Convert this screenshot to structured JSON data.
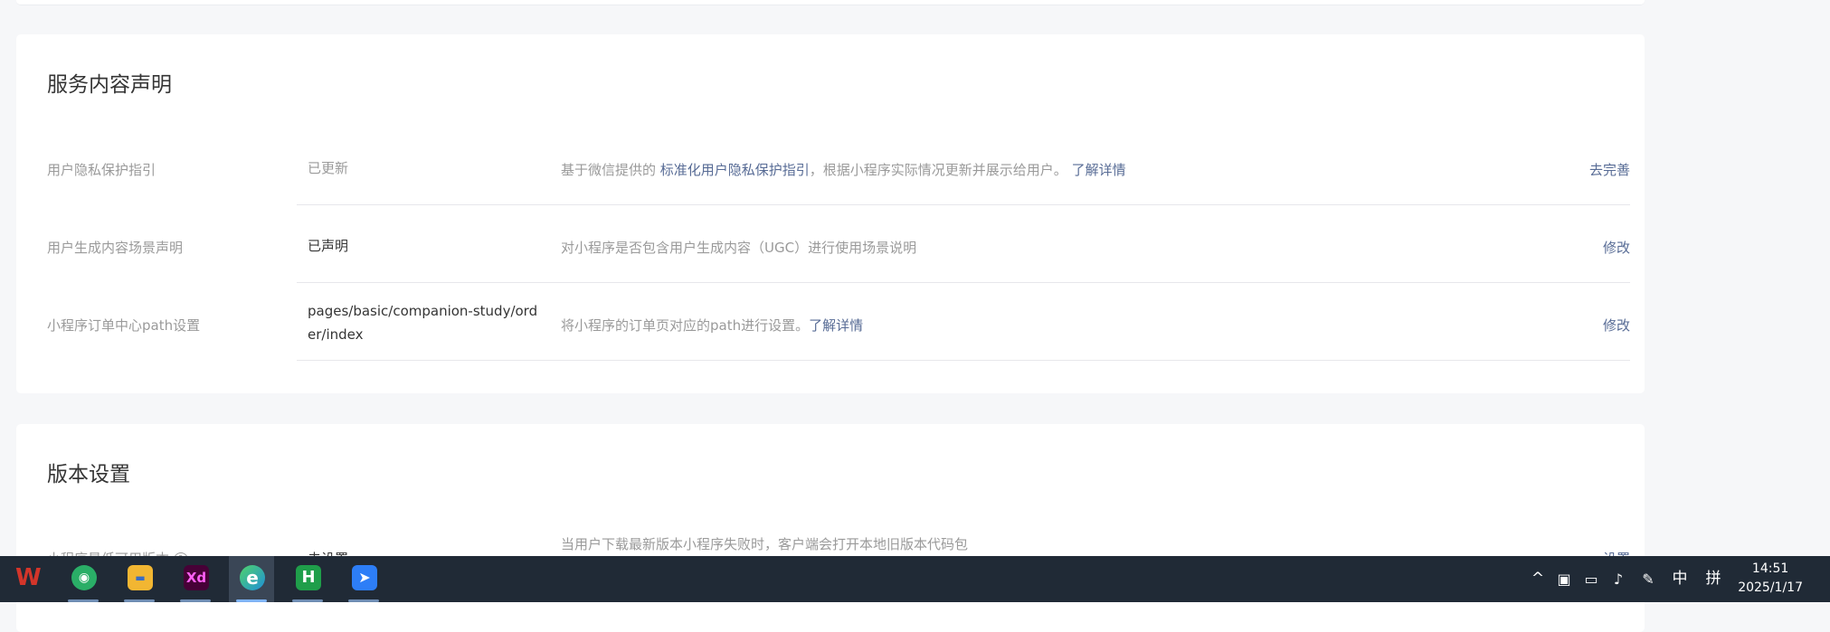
{
  "service_section": {
    "title": "服务内容声明",
    "rows": [
      {
        "label": "用户隐私保护指引",
        "value": "已更新",
        "desc_pre": "基于微信提供的 ",
        "desc_link": "标准化用户隐私保护指引",
        "desc_mid": "，根据小程序实际情况更新并展示给用户。 ",
        "desc_link2": "了解详情",
        "action": "去完善"
      },
      {
        "label": "用户生成内容场景声明",
        "value": "已声明",
        "desc": "对小程序是否包含用户生成内容（UGC）进行使用场景说明",
        "action": "修改"
      },
      {
        "label": "小程序订单中心path设置",
        "value": "pages/basic/companion-study/order/index",
        "desc_pre": "将小程序的订单页对应的path进行设置。",
        "desc_link": "了解详情",
        "action": "修改"
      }
    ]
  },
  "version_section": {
    "title": "版本设置",
    "row": {
      "label": "小程序最低可用版本",
      "value": "未设置",
      "desc": "当用户下载最新版本小程序失败时，客户端会打开本地旧版本代码包",
      "action": "设置"
    }
  },
  "taskbar": {
    "apps": [
      {
        "name": "WPS",
        "glyph": "W",
        "color": "#d3352a"
      },
      {
        "name": "WeChat",
        "glyph": "◉",
        "color": "#2aae67"
      },
      {
        "name": "File Explorer",
        "glyph": "▬",
        "color": "#f2b632"
      },
      {
        "name": "Adobe XD",
        "glyph": "Xd",
        "color": "#470137"
      },
      {
        "name": "Microsoft Edge",
        "glyph": "e",
        "color": "#1f8fd8"
      },
      {
        "name": "HBuilderX",
        "glyph": "H",
        "color": "#1f9e4a"
      },
      {
        "name": "Feishu",
        "glyph": "➤",
        "color": "#2d7ef7"
      }
    ],
    "ime_lang": "中",
    "ime_mode": "拼",
    "time": "14:51",
    "date": "2025/1/17"
  }
}
